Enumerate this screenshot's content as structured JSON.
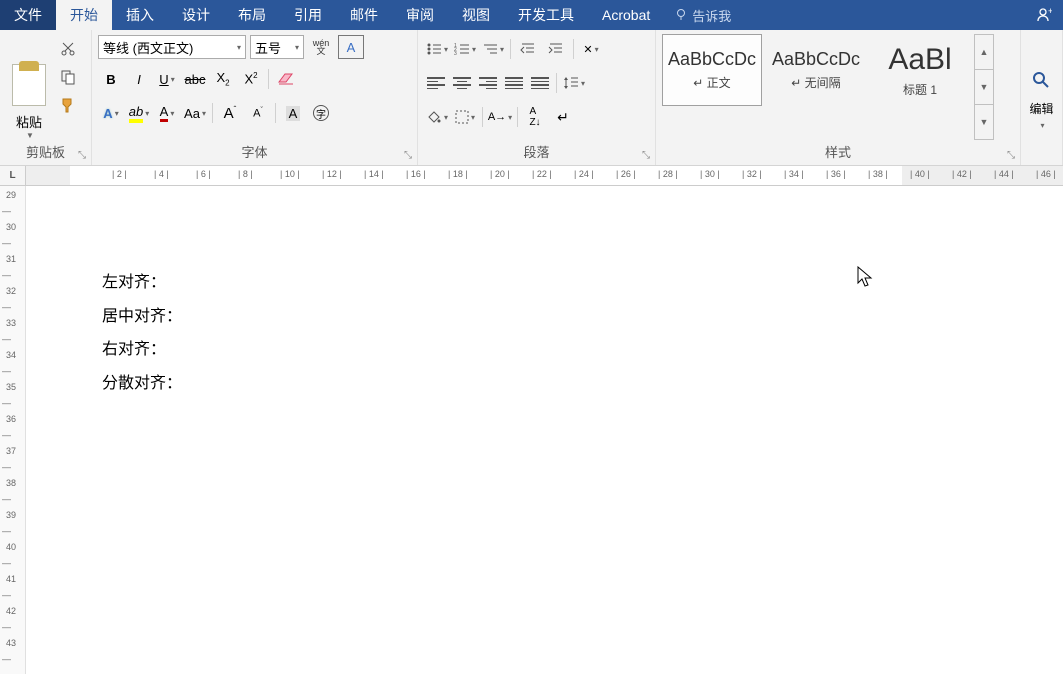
{
  "menu": {
    "file": "文件",
    "home": "开始",
    "insert": "插入",
    "design": "设计",
    "layout": "布局",
    "references": "引用",
    "mail": "邮件",
    "review": "审阅",
    "view": "视图",
    "developer": "开发工具",
    "acrobat": "Acrobat",
    "tell_me": "告诉我"
  },
  "clipboard": {
    "paste": "粘贴",
    "label": "剪贴板"
  },
  "font": {
    "name": "等线 (西文正文)",
    "size": "五号",
    "wen_top": "wén",
    "wen_bottom": "文",
    "char_a": "A",
    "label": "字体"
  },
  "paragraph": {
    "label": "段落"
  },
  "styles": {
    "items": [
      {
        "preview": "AaBbCcDc",
        "label": "↵ 正文"
      },
      {
        "preview": "AaBbCcDc",
        "label": "↵ 无间隔"
      },
      {
        "preview": "AaBl",
        "label": "标题 1"
      }
    ],
    "label": "样式"
  },
  "editing": {
    "label": "编辑"
  },
  "ruler": {
    "h_marks": [
      2,
      4,
      6,
      8,
      10,
      12,
      14,
      16,
      18,
      20,
      22,
      24,
      26,
      28,
      30,
      32,
      34,
      36,
      38,
      40,
      42,
      44,
      46
    ],
    "v_marks": [
      29,
      30,
      31,
      32,
      33,
      34,
      35,
      36,
      37,
      38,
      39,
      40,
      41,
      42,
      43
    ]
  },
  "document": {
    "lines": [
      "左对齐：",
      "居中对齐：",
      "右对齐：",
      "分散对齐："
    ]
  }
}
